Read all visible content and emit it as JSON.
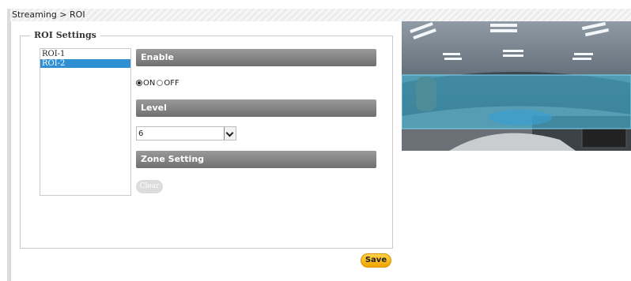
{
  "breadcrumb": "Streaming > ROI",
  "roi_settings": {
    "legend": "ROI Settings",
    "roi_list": [
      "ROI-1",
      "ROI-2"
    ],
    "selected_roi": "ROI-2"
  },
  "enable": {
    "header": "Enable",
    "on_label": "ON",
    "off_label": "OFF",
    "selected": "ON"
  },
  "level": {
    "header": "Level",
    "value": "6"
  },
  "zone_setting": {
    "header": "Zone Setting",
    "clear_label": "Clear"
  },
  "save_label": "Save",
  "colors": {
    "section_header": "#7f7f7f",
    "selected_item": "#2f8fd3",
    "save_button": "#f5b300",
    "roi_overlay": "#46c2e8"
  }
}
